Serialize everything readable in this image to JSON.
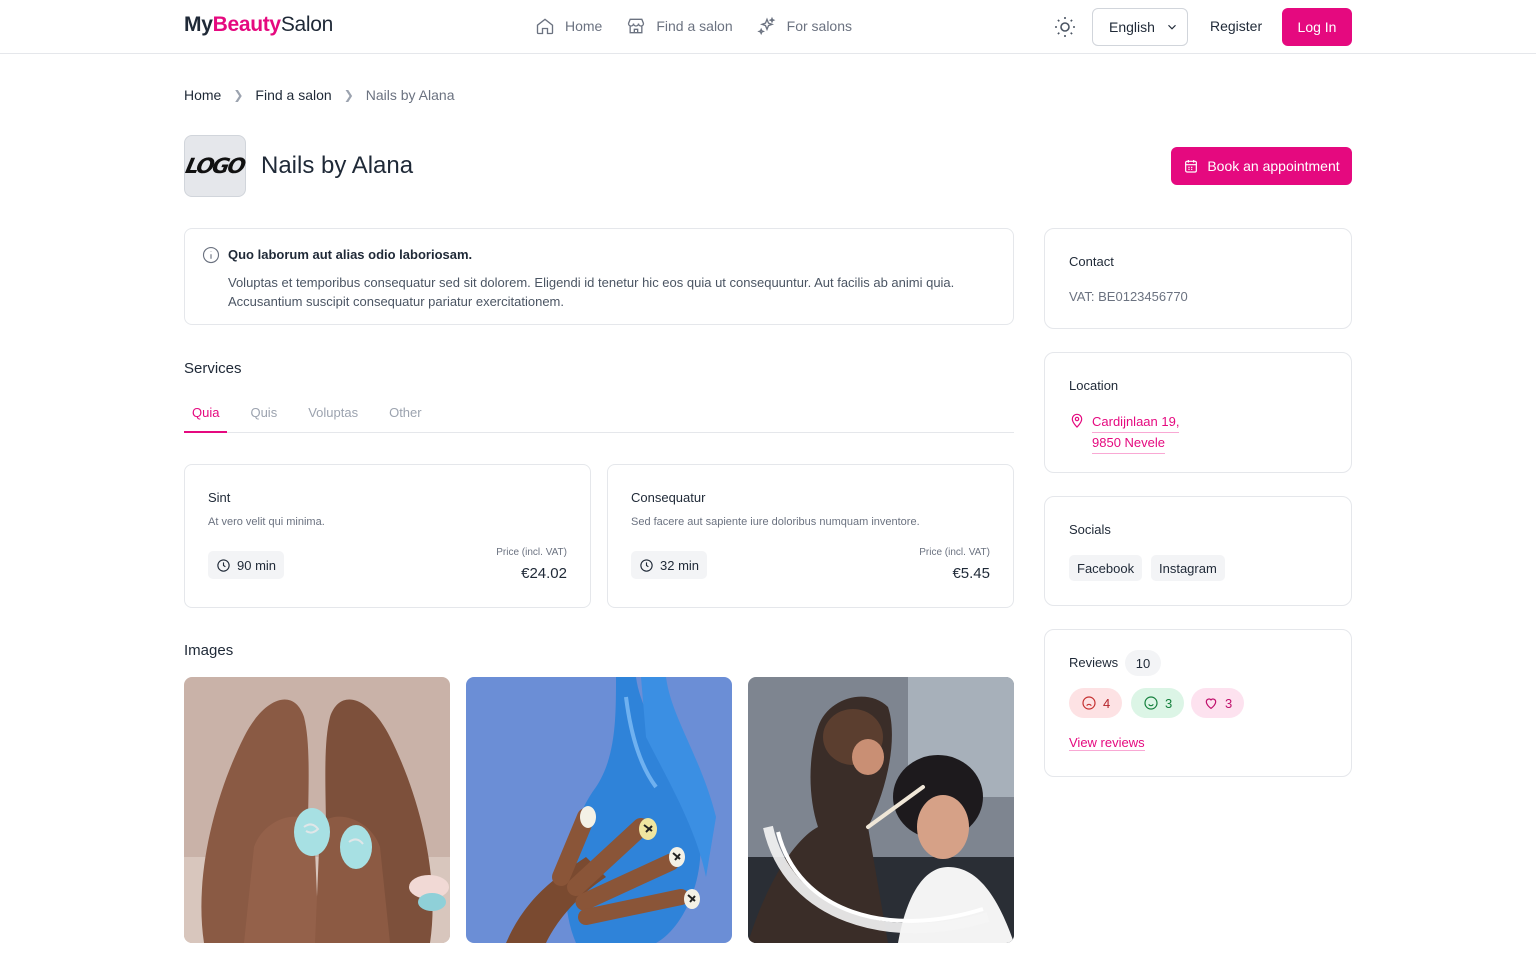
{
  "header": {
    "logo": {
      "my": "My",
      "beauty": "Beauty",
      "salon": "Salon"
    },
    "nav": [
      {
        "label": "Home",
        "icon": "home-icon"
      },
      {
        "label": "Find a salon",
        "icon": "store-icon"
      },
      {
        "label": "For salons",
        "icon": "sparkles-icon"
      }
    ],
    "theme_icon": "sun-icon",
    "language": "English",
    "register": "Register",
    "login": "Log In",
    "accent_color": "#e5097f"
  },
  "breadcrumb": [
    "Home",
    "Find a salon",
    "Nails by Alana"
  ],
  "salon": {
    "logo_text": "LOGO",
    "name": "Nails by Alana",
    "book_button": "Book an appointment"
  },
  "info": {
    "title": "Quo laborum aut alias odio laboriosam.",
    "body": "Voluptas et temporibus consequatur sed sit dolorem. Eligendi id tenetur hic eos quia ut consequuntur. Aut facilis ab animi quia. Accusantium suscipit consequatur pariatur exercitationem."
  },
  "services": {
    "title": "Services",
    "tabs": [
      "Quia",
      "Quis",
      "Voluptas",
      "Other"
    ],
    "active_tab": "Quia",
    "items": [
      {
        "name": "Sint",
        "description": "At vero velit qui minima.",
        "duration": "90 min",
        "price_label": "Price (incl. VAT)",
        "price": "€24.02"
      },
      {
        "name": "Consequatur",
        "description": "Sed facere aut sapiente iure doloribus numquam inventore.",
        "duration": "32 min",
        "price_label": "Price (incl. VAT)",
        "price": "€5.45"
      }
    ]
  },
  "images": {
    "title": "Images",
    "items": [
      "nail-art-photo",
      "blue-mannequin-nails-photo",
      "makeup-artist-photo"
    ]
  },
  "sidebar": {
    "contact": {
      "title": "Contact",
      "vat": "VAT: BE0123456770"
    },
    "location": {
      "title": "Location",
      "line1": "Cardijnlaan 19,",
      "line2": "9850 Nevele"
    },
    "socials": {
      "title": "Socials",
      "items": [
        "Facebook",
        "Instagram"
      ]
    },
    "reviews": {
      "title": "Reviews",
      "count": "10",
      "negative": "4",
      "positive": "3",
      "love": "3",
      "link": "View reviews"
    }
  }
}
